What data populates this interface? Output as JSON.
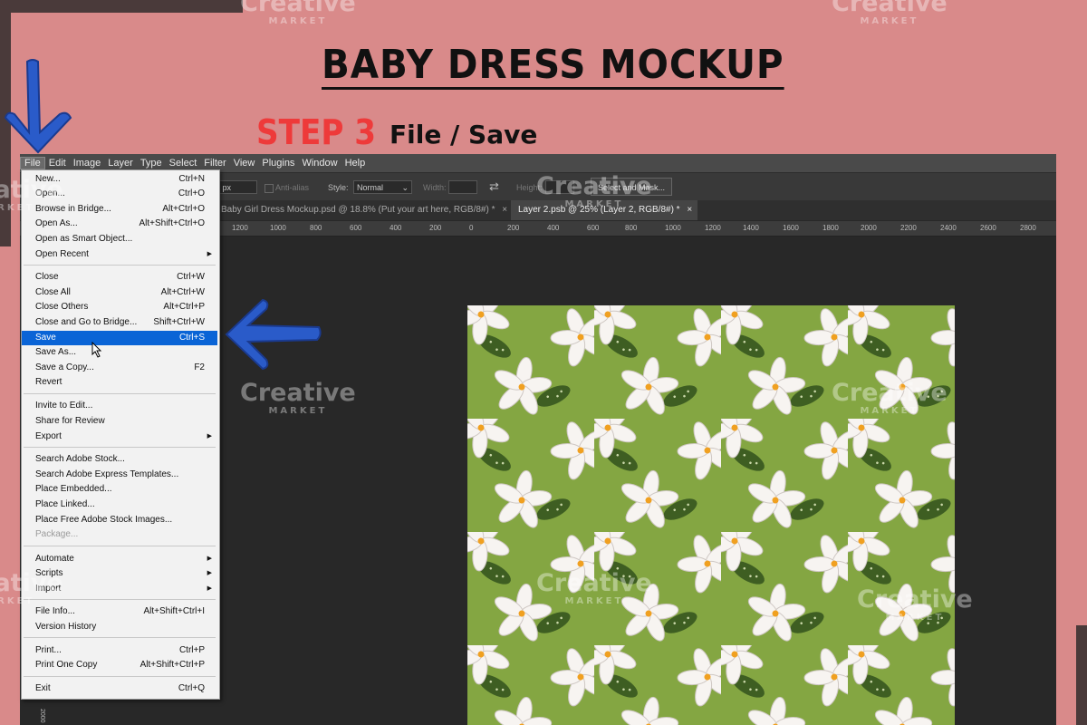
{
  "header": {
    "title": "BABY DRESS MOCKUP",
    "step": "STEP 3",
    "instruction": "File / Save"
  },
  "menubar": [
    "File",
    "Edit",
    "Image",
    "Layer",
    "Type",
    "Select",
    "Filter",
    "View",
    "Plugins",
    "Window",
    "Help"
  ],
  "options_bar": {
    "feather_value": "0 px",
    "anti_alias": "Anti-alias",
    "style_label": "Style:",
    "style_value": "Normal",
    "width_label": "Width:",
    "height_label": "Height:",
    "select_mask_button": "Select and Mask..."
  },
  "tabs": [
    {
      "label": "Baby Girl Dress Mockup.psd @ 18.8% (Put your art here, RGB/8#) *",
      "close": "×"
    },
    {
      "label": "Layer 2.psb @ 25% (Layer 2, RGB/8#) *",
      "close": "×"
    }
  ],
  "ruler_h": [
    "1200",
    "1000",
    "800",
    "600",
    "400",
    "200",
    "0",
    "200",
    "400",
    "600",
    "800",
    "1000",
    "1200",
    "1400",
    "1600",
    "1800",
    "2000",
    "2200",
    "2400",
    "2600",
    "2800"
  ],
  "ruler_v_label": "2000",
  "file_menu": {
    "items": [
      {
        "label": "New...",
        "shortcut": "Ctrl+N"
      },
      {
        "label": "Open...",
        "shortcut": "Ctrl+O"
      },
      {
        "label": "Browse in Bridge...",
        "shortcut": "Alt+Ctrl+O"
      },
      {
        "label": "Open As...",
        "shortcut": "Alt+Shift+Ctrl+O"
      },
      {
        "label": "Open as Smart Object...",
        "shortcut": ""
      },
      {
        "label": "Open Recent",
        "shortcut": ""
      },
      {
        "label": "Close",
        "shortcut": "Ctrl+W"
      },
      {
        "label": "Close All",
        "shortcut": "Alt+Ctrl+W"
      },
      {
        "label": "Close Others",
        "shortcut": "Alt+Ctrl+P"
      },
      {
        "label": "Close and Go to Bridge...",
        "shortcut": "Shift+Ctrl+W"
      },
      {
        "label": "Save",
        "shortcut": "Ctrl+S"
      },
      {
        "label": "Save As...",
        "shortcut": ""
      },
      {
        "label": "Save a Copy...",
        "shortcut": "F2"
      },
      {
        "label": "Revert",
        "shortcut": ""
      },
      {
        "label": "Invite to Edit...",
        "shortcut": ""
      },
      {
        "label": "Share for Review",
        "shortcut": ""
      },
      {
        "label": "Export",
        "shortcut": ""
      },
      {
        "label": "Search Adobe Stock...",
        "shortcut": ""
      },
      {
        "label": "Search Adobe Express Templates...",
        "shortcut": ""
      },
      {
        "label": "Place Embedded...",
        "shortcut": ""
      },
      {
        "label": "Place Linked...",
        "shortcut": ""
      },
      {
        "label": "Place Free Adobe Stock Images...",
        "shortcut": ""
      },
      {
        "label": "Package...",
        "shortcut": ""
      },
      {
        "label": "Automate",
        "shortcut": ""
      },
      {
        "label": "Scripts",
        "shortcut": ""
      },
      {
        "label": "Import",
        "shortcut": ""
      },
      {
        "label": "File Info...",
        "shortcut": "Alt+Shift+Ctrl+I"
      },
      {
        "label": "Version History",
        "shortcut": ""
      },
      {
        "label": "Print...",
        "shortcut": "Ctrl+P"
      },
      {
        "label": "Print One Copy",
        "shortcut": "Alt+Shift+Ctrl+P"
      },
      {
        "label": "Exit",
        "shortcut": "Ctrl+Q"
      }
    ]
  },
  "watermark": {
    "brand": "Creative",
    "sub": "MARKET"
  },
  "colors": {
    "background": "#d98a8a",
    "step": "#ee3a3a",
    "highlight": "#0a64d6",
    "arrow": "#2a5bc9",
    "pattern_bg": "#84a642"
  }
}
